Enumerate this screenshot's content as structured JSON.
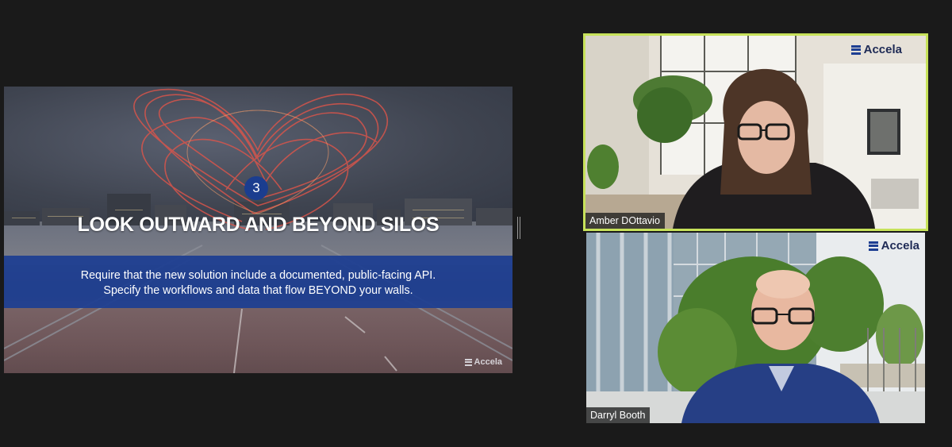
{
  "slide": {
    "step_number": "3",
    "title": "LOOK OUTWARD AND BEYOND SILOS",
    "body_line1": "Require that the new solution include a documented, public-facing API.",
    "body_line2": "Specify the workflows and data that flow BEYOND your walls.",
    "logo_text": "Accela"
  },
  "participants": [
    {
      "name": "Amber DOttavio",
      "logo_text": "Accela",
      "active_speaker": true
    },
    {
      "name": "Darryl Booth",
      "logo_text": "Accela",
      "active_speaker": false
    }
  ],
  "colors": {
    "background": "#1a1a1a",
    "active_speaker_border": "#c7e25a",
    "slide_band": "#1e3f92",
    "brand_navy": "#1e2a55"
  }
}
